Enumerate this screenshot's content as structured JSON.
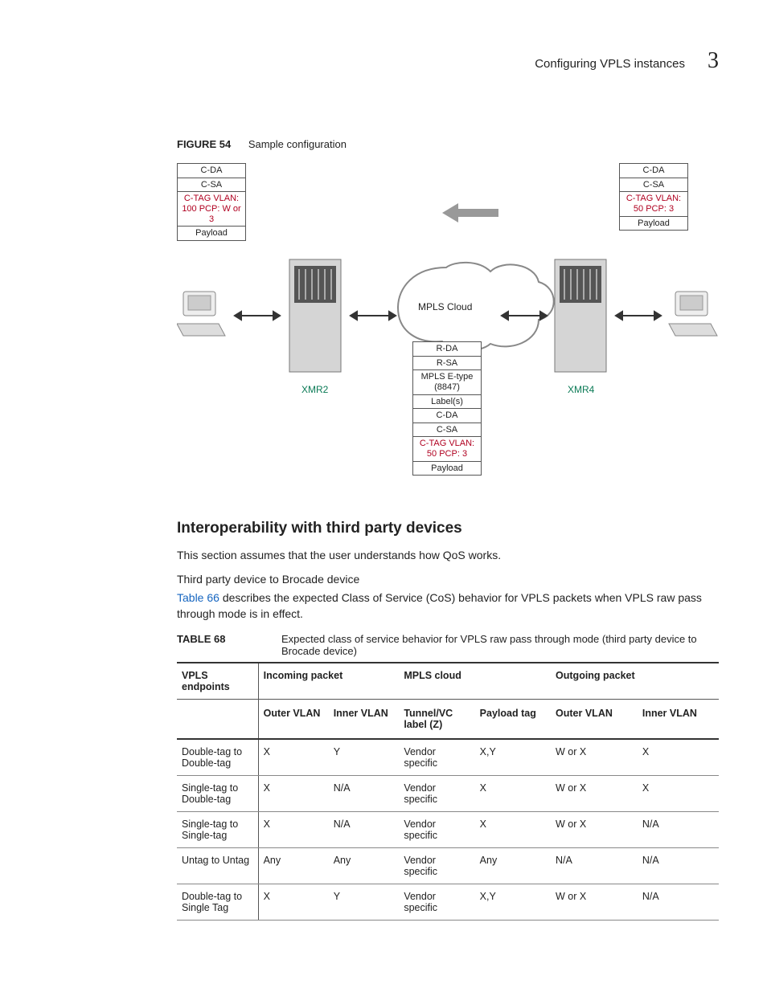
{
  "header": {
    "title": "Configuring VPLS instances",
    "chapter": "3"
  },
  "figure": {
    "label": "FIGURE 54",
    "caption": "Sample configuration",
    "left_stack": [
      "C-DA",
      "C-SA",
      "C-TAG\nVLAN: 100\nPCP: W or 3",
      "Payload"
    ],
    "right_stack": [
      "C-DA",
      "C-SA",
      "C-TAG\nVLAN: 50\nPCP: 3",
      "Payload"
    ],
    "center_stack": [
      "R-DA",
      "R-SA",
      "MPLS E-type\n(8847)",
      "Label(s)",
      "C-DA",
      "C-SA",
      "C-TAG\nVLAN: 50\nPCP: 3",
      "Payload"
    ],
    "cloud_label": "MPLS Cloud",
    "left_device": "XMR2",
    "right_device": "XMR4"
  },
  "section": {
    "heading": "Interoperability with third party devices",
    "p1": "This section assumes that the user understands how QoS works.",
    "p2": "Third party device to Brocade device",
    "p3_link": "Table 66",
    "p3_rest": " describes the expected Class of Service (CoS) behavior for VPLS packets when VPLS raw pass through mode is in effect."
  },
  "table": {
    "label": "TABLE 68",
    "caption": "Expected class of service behavior for VPLS raw pass through mode (third party device to Brocade device)",
    "group_headers": [
      "VPLS endpoints",
      "Incoming packet",
      "MPLS cloud",
      "Outgoing packet"
    ],
    "sub_headers": [
      "",
      "Outer VLAN",
      "Inner VLAN",
      "Tunnel/VC label (Z)",
      "Payload tag",
      "Outer VLAN",
      "Inner VLAN"
    ],
    "rows": [
      [
        "Double-tag to Double-tag",
        "X",
        "Y",
        "Vendor specific",
        "X,Y",
        "W or X",
        "X"
      ],
      [
        "Single-tag to Double-tag",
        "X",
        "N/A",
        "Vendor specific",
        "X",
        "W or X",
        "X"
      ],
      [
        "Single-tag to Single-tag",
        "X",
        "N/A",
        "Vendor specific",
        "X",
        "W or X",
        "N/A"
      ],
      [
        "Untag to Untag",
        "Any",
        "Any",
        "Vendor specific",
        "Any",
        "N/A",
        "N/A"
      ],
      [
        "Double-tag to Single Tag",
        "X",
        "Y",
        "Vendor specific",
        "X,Y",
        "W or X",
        "N/A"
      ]
    ]
  }
}
